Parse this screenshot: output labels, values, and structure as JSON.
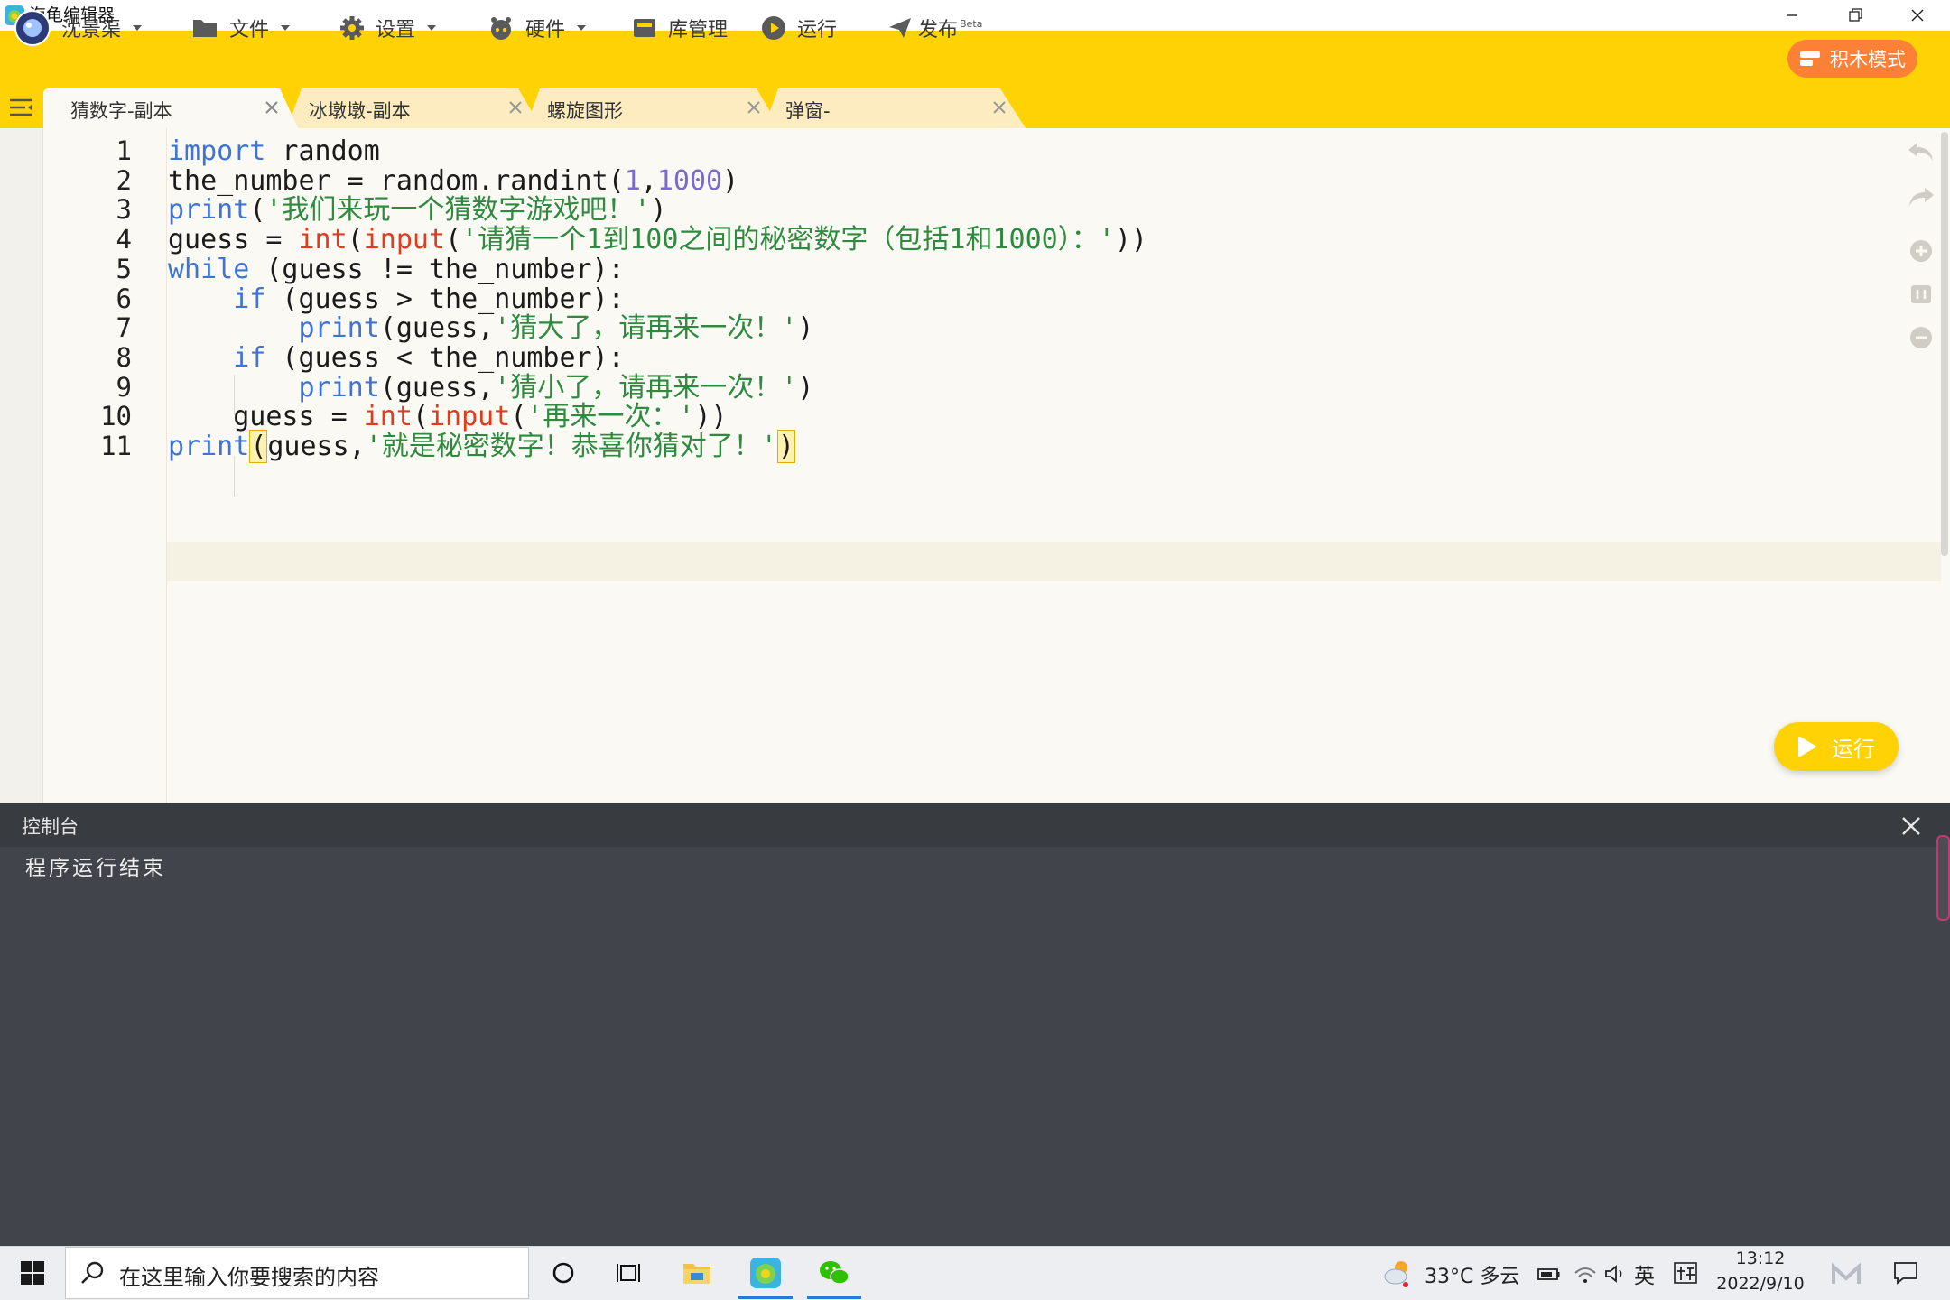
{
  "window": {
    "title": "海龟编辑器"
  },
  "toolbar": {
    "user": "沈景渠",
    "file": "文件",
    "settings": "设置",
    "hardware": "硬件",
    "library": "库管理",
    "run": "运行",
    "publish": "发布",
    "publish_badge": "Beta",
    "block_mode": "积木模式"
  },
  "tabs": [
    {
      "label": "猜数字-副本",
      "active": true
    },
    {
      "label": "冰墩墩-副本",
      "active": false
    },
    {
      "label": "螺旋图形",
      "active": false
    },
    {
      "label": "弹窗-",
      "active": false
    }
  ],
  "editor": {
    "line_numbers": [
      "1",
      "2",
      "3",
      "4",
      "5",
      "6",
      "7",
      "8",
      "9",
      "10",
      "11"
    ],
    "lines": [
      [
        {
          "t": "import",
          "c": "kw"
        },
        {
          "t": " random",
          "c": ""
        }
      ],
      [
        {
          "t": "the_number = random.randint(",
          "c": ""
        },
        {
          "t": "1",
          "c": "num"
        },
        {
          "t": ",",
          "c": ""
        },
        {
          "t": "1000",
          "c": "num"
        },
        {
          "t": ")",
          "c": ""
        }
      ],
      [
        {
          "t": "print",
          "c": "fn"
        },
        {
          "t": "(",
          "c": ""
        },
        {
          "t": "'我们来玩一个猜数字游戏吧！'",
          "c": "str"
        },
        {
          "t": ")",
          "c": ""
        }
      ],
      [
        {
          "t": "guess = ",
          "c": ""
        },
        {
          "t": "int",
          "c": "bi"
        },
        {
          "t": "(",
          "c": ""
        },
        {
          "t": "input",
          "c": "bi"
        },
        {
          "t": "(",
          "c": ""
        },
        {
          "t": "'请猜一个1到100之间的秘密数字（包括1和1000）：'",
          "c": "str"
        },
        {
          "t": "))",
          "c": ""
        }
      ],
      [
        {
          "t": "while",
          "c": "kw"
        },
        {
          "t": " (guess != the_number):",
          "c": ""
        }
      ],
      [
        {
          "t": "    ",
          "c": ""
        },
        {
          "t": "if",
          "c": "kw"
        },
        {
          "t": " (guess > the_number):",
          "c": ""
        }
      ],
      [
        {
          "t": "        ",
          "c": ""
        },
        {
          "t": "print",
          "c": "fn"
        },
        {
          "t": "(guess,",
          "c": ""
        },
        {
          "t": "'猜大了，请再来一次！'",
          "c": "str"
        },
        {
          "t": ")",
          "c": ""
        }
      ],
      [
        {
          "t": "    ",
          "c": ""
        },
        {
          "t": "if",
          "c": "kw"
        },
        {
          "t": " (guess < the_number):",
          "c": ""
        }
      ],
      [
        {
          "t": "        ",
          "c": ""
        },
        {
          "t": "print",
          "c": "fn"
        },
        {
          "t": "(guess,",
          "c": ""
        },
        {
          "t": "'猜小了，请再来一次！'",
          "c": "str"
        },
        {
          "t": ")",
          "c": ""
        }
      ],
      [
        {
          "t": "    guess = ",
          "c": ""
        },
        {
          "t": "int",
          "c": "bi"
        },
        {
          "t": "(",
          "c": ""
        },
        {
          "t": "input",
          "c": "bi"
        },
        {
          "t": "(",
          "c": ""
        },
        {
          "t": "'再来一次：'",
          "c": "str"
        },
        {
          "t": "))",
          "c": ""
        }
      ],
      [
        {
          "t": "print",
          "c": "fn"
        },
        {
          "t": "(",
          "c": "hl"
        },
        {
          "t": "guess,",
          "c": ""
        },
        {
          "t": "'就是秘密数字！恭喜你猜对了！'",
          "c": "str"
        },
        {
          "t": ")",
          "c": "hl"
        }
      ]
    ],
    "run_button": "运行"
  },
  "console": {
    "title": "控制台",
    "output": "程序运行结束"
  },
  "taskbar": {
    "search_placeholder": "在这里输入你要搜索的内容",
    "weather": "33°C 多云",
    "language": "英",
    "time": "13:12",
    "date": "2022/9/10"
  },
  "colors": {
    "toolbar": "#fed204",
    "accent_orange": "#fc8035",
    "keyword": "#3f74d2",
    "builtin": "#e03b1c",
    "string": "#2d8a3e",
    "number": "#7a6acb",
    "console_bg": "#41444a"
  }
}
